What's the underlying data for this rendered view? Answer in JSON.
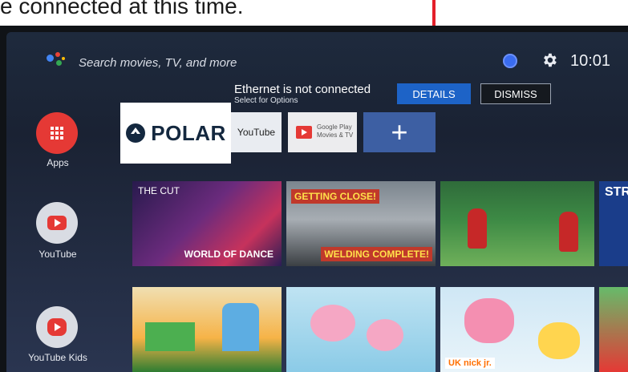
{
  "caption": {
    "text": "e connected at this time."
  },
  "header": {
    "search_placeholder": "Search movies, TV, and more",
    "clock": "10:01"
  },
  "banner": {
    "title": "Ethernet is not connected",
    "subtitle": "Select for Options",
    "details_label": "DETAILS",
    "dismiss_label": "DISMISS"
  },
  "sidebar": {
    "items": [
      {
        "label": "Apps",
        "icon": "apps-grid-icon",
        "color": "#e53935"
      },
      {
        "label": "YouTube",
        "icon": "youtube-play-icon",
        "color": "#e53935"
      },
      {
        "label": "YouTube Kids",
        "icon": "youtube-kids-icon",
        "color": "#e53935"
      }
    ]
  },
  "favorites": {
    "polar": "POLAR",
    "youtube": "YouTube",
    "google_play": [
      "Google Play",
      "Movies & TV"
    ],
    "add": "+"
  },
  "row1": [
    {
      "title": "THE CUT",
      "extra": "WORLD OF DANCE"
    },
    {
      "caption_top": "GETTING CLOSE!",
      "caption_bottom": "WELDING COMPLETE!"
    },
    {
      "title": ""
    },
    {
      "title": "STR"
    }
  ],
  "row2": [
    {
      "title": ""
    },
    {
      "title": ""
    },
    {
      "badge": "UK nick jr."
    },
    {
      "title": ""
    }
  ],
  "colors": {
    "arrow": "#e4202a",
    "details_button": "#1d63c7",
    "screen_bg": "#1e2a3d"
  }
}
